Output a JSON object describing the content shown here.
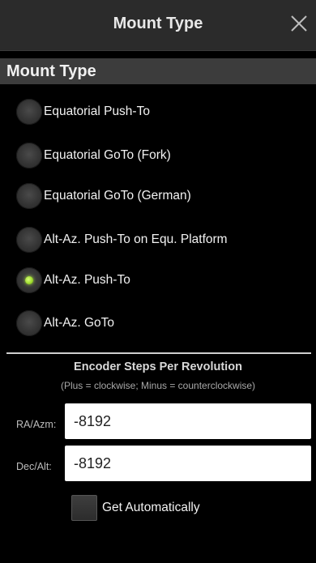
{
  "header": {
    "title": "Mount Type",
    "close_icon": "close-icon"
  },
  "section": {
    "title": "Mount Type"
  },
  "mount_options": [
    {
      "label": "Equatorial Push-To",
      "selected": false
    },
    {
      "label": "Equatorial GoTo (Fork)",
      "selected": false
    },
    {
      "label": "Equatorial GoTo (German)",
      "selected": false
    },
    {
      "label": "Alt-Az. Push-To on Equ. Platform",
      "selected": false
    },
    {
      "label": "Alt-Az. Push-To",
      "selected": true
    },
    {
      "label": "Alt-Az. GoTo",
      "selected": false
    }
  ],
  "encoder": {
    "title": "Encoder Steps Per Revolution",
    "subtitle": "(Plus = clockwise; Minus = counterclockwise)",
    "ra_label": "RA/Azm:",
    "ra_value": "-8192",
    "dec_label": "Dec/Alt:",
    "dec_value": "-8192",
    "auto_label": "Get Automatically",
    "auto_checked": false
  },
  "colors": {
    "background": "#000000",
    "title_bar": "#2b2b2b",
    "section_header": "#3c3c3c",
    "radio_selected": "#9bd92a"
  }
}
